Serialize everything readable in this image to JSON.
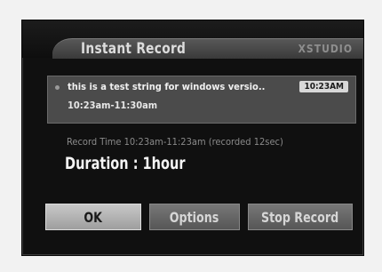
{
  "dialog": {
    "title": "Instant Record",
    "brand": "XSTUDIO",
    "program": {
      "title": "this is a test string for windows versio..",
      "time_range": "10:23am-11:30am",
      "clock": "10:23AM"
    },
    "record_time": "Record Time 10:23am-11:23am (recorded 12sec)",
    "duration": "Duration : 1hour",
    "buttons": {
      "ok": "OK",
      "options": "Options",
      "stop_record": "Stop Record"
    }
  }
}
